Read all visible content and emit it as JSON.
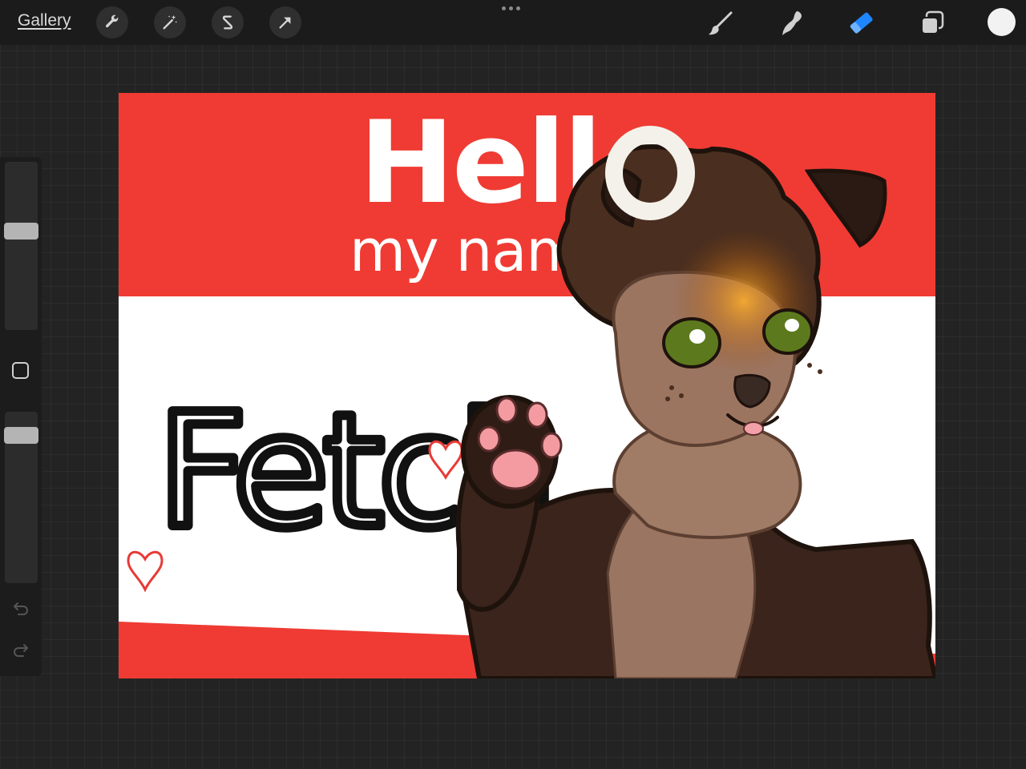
{
  "toolbar": {
    "gallery_label": "Gallery",
    "left_tools": [
      "wrench-icon",
      "magic-wand-icon",
      "selection-icon",
      "transform-arrow-icon"
    ],
    "right_tools": [
      "brush-icon",
      "smudge-icon",
      "eraser-icon",
      "layers-icon"
    ],
    "active_tool": "eraser",
    "accent_color": "#1e86ff",
    "current_color": "#f2f2f2"
  },
  "sidebar": {
    "brush_size_level": 0.6,
    "opacity_level": 0.9,
    "icons": [
      "modify-square-icon",
      "undo-icon",
      "redo-icon"
    ]
  },
  "artwork": {
    "hello_text": "Hello",
    "my_name_is_text": "my name is",
    "name_text": "Fetch",
    "banner_color": "#ef3b33"
  }
}
